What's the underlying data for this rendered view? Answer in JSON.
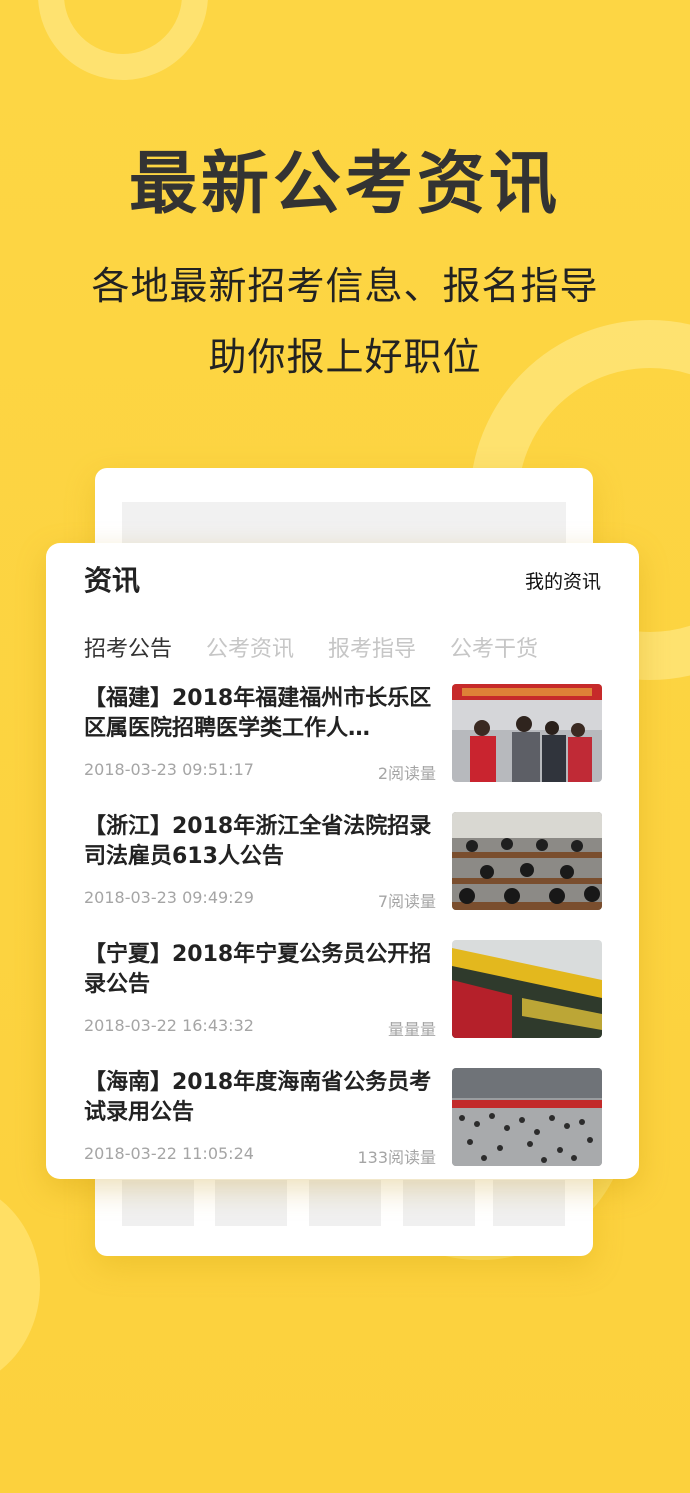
{
  "headline": "最新公考资讯",
  "subtitle_line1": "各地最新招考信息、报名指导",
  "subtitle_line2": "助你报上好职位",
  "card": {
    "title": "资讯",
    "my_link": "我的资讯",
    "tabs": [
      {
        "label": "招考公告",
        "active": true
      },
      {
        "label": "公考资讯",
        "active": false
      },
      {
        "label": "报考指导",
        "active": false
      },
      {
        "label": "公考干货",
        "active": false
      }
    ],
    "news": [
      {
        "title": "【福建】2018年福建福州市长乐区区属医院招聘医学类工作人…",
        "date": "2018-03-23 09:51:17",
        "reads": "2阅读量",
        "thumb": "students-crowd-photo"
      },
      {
        "title": "【浙江】2018年浙江全省法院招录司法雇员613人公告",
        "date": "2018-03-23 09:49:29",
        "reads": "7阅读量",
        "thumb": "exam-hall-photo"
      },
      {
        "title": "【宁夏】2018年宁夏公务员公开招录公告",
        "date": "2018-03-22 16:43:32",
        "reads": "量量量",
        "thumb": "civil-servant-book-photo"
      },
      {
        "title": "【海南】2018年度海南省公务员考试录用公告",
        "date": "2018-03-22 11:05:24",
        "reads": "133阅读量",
        "thumb": "exam-crowd-photo"
      }
    ]
  },
  "colors": {
    "background": "#fdd443",
    "headline": "#333333",
    "tab_inactive": "#c6c6c6"
  }
}
